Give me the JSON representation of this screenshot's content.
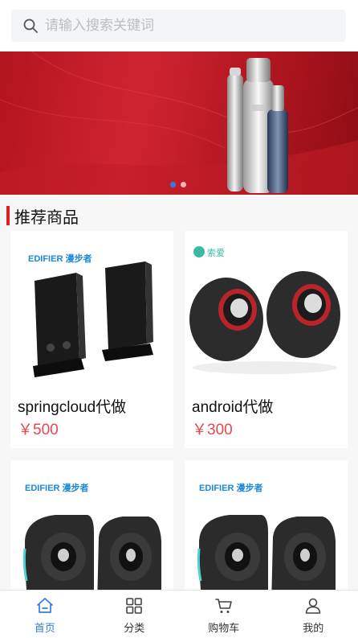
{
  "search": {
    "placeholder": "请输入搜索关键词",
    "value": ""
  },
  "banner": {
    "slide_count": 2,
    "active_slide": 1
  },
  "section": {
    "title": "推荐商品"
  },
  "products": [
    {
      "name": "springcloud代做",
      "price": "￥500",
      "brand": "EDIFIER 漫步者"
    },
    {
      "name": "android代做",
      "price": "￥300",
      "brand": "索爱"
    },
    {
      "name": "",
      "price": "",
      "brand": "EDIFIER 漫步者"
    },
    {
      "name": "",
      "price": "",
      "brand": "EDIFIER 漫步者"
    }
  ],
  "tabbar": {
    "items": [
      {
        "label": "首页",
        "icon": "home-icon",
        "active": true
      },
      {
        "label": "分类",
        "icon": "grid-icon",
        "active": false
      },
      {
        "label": "购物车",
        "icon": "cart-icon",
        "active": false
      },
      {
        "label": "我的",
        "icon": "user-icon",
        "active": false
      }
    ]
  },
  "colors": {
    "accent": "#2f7de1",
    "price": "#e5484d",
    "section_bar": "#e0211f"
  }
}
